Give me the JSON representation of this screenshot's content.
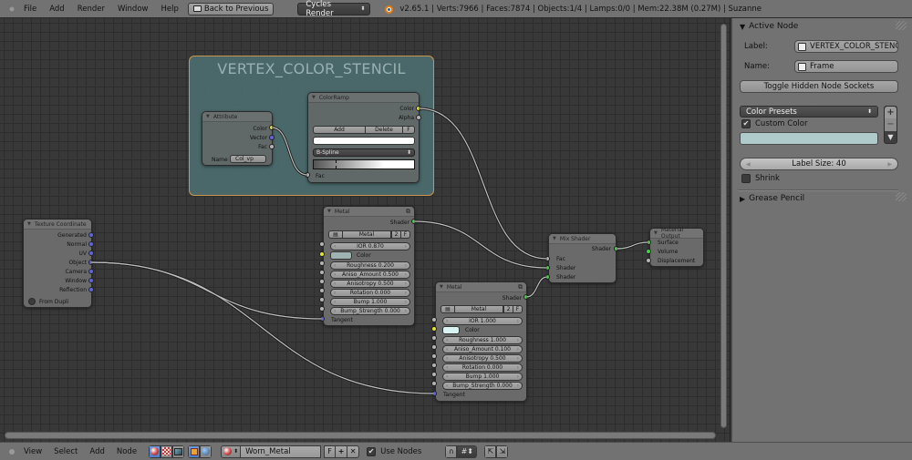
{
  "topbar": {
    "menus": [
      "File",
      "Add",
      "Render",
      "Window",
      "Help"
    ],
    "back_button": "Back to Previous",
    "render_engine": "Cycles Render",
    "stats": "v2.65.1 | Verts:7966 | Faces:7874 | Objects:1/4 | Lamps:0/0 | Mem:22.38M (0.27M) | Suzanne"
  },
  "properties": {
    "active_node_header": "Active Node",
    "label_caption": "Label:",
    "label_value": "VERTEX_COLOR_STENCIL",
    "name_caption": "Name:",
    "name_value": "Frame",
    "toggle_button": "Toggle Hidden Node Sockets",
    "color_presets": "Color Presets",
    "custom_color": "Custom Color",
    "custom_color_checked": true,
    "custom_color_hex": "#b0cacc",
    "label_size": "Label Size: 40",
    "shrink": "Shrink",
    "shrink_checked": false,
    "grease_pencil_header": "Grease Pencil"
  },
  "frame": {
    "label": "VERTEX_COLOR_STENCIL"
  },
  "nodes": {
    "attribute": {
      "title": "Attribute",
      "outputs": [
        "Color",
        "Vector",
        "Fac"
      ],
      "name_label": "Name",
      "name_value": "Col_vp"
    },
    "colorramp": {
      "title": "ColorRamp",
      "outputs": [
        "Color",
        "Alpha"
      ],
      "add": "Add",
      "delete": "Delete",
      "flip": "F",
      "interpolation": "B-Spline",
      "input": "Fac"
    },
    "texcoord": {
      "title": "Texture Coordinate",
      "outputs": [
        "Generated",
        "Normal",
        "UV",
        "Object",
        "Camera",
        "Window",
        "Reflection"
      ],
      "from_dupli": "From Dupli"
    },
    "metal1": {
      "title": "Metal",
      "output": "Shader",
      "group_name": "Metal",
      "users": "2",
      "fake": "F",
      "fields": [
        "IOR 0.870",
        "Roughness 0.200",
        "Aniso_Amount 0.500",
        "Anisotropy 0.500",
        "Rotation 0.000",
        "Bump 1.000",
        "Bump_Strength 0.000"
      ],
      "color_label": "Color",
      "color_hex": "#9fb3b3",
      "tangent": "Tangent"
    },
    "metal2": {
      "title": "Metal",
      "output": "Shader",
      "group_name": "Metal",
      "users": "2",
      "fake": "F",
      "fields": [
        "IOR 1.000",
        "Roughness 1.000",
        "Aniso_Amount 0.100",
        "Anisotropy 0.500",
        "Rotation 0.000",
        "Bump 1.000",
        "Bump_Strength 0.000"
      ],
      "color_label": "Color",
      "color_hex": "#d9f2f2",
      "tangent": "Tangent"
    },
    "mixshader": {
      "title": "Mix Shader",
      "output": "Shader",
      "inputs": [
        "Fac",
        "Shader",
        "Shader"
      ]
    },
    "output": {
      "title": "Material Output",
      "inputs": [
        "Surface",
        "Volume",
        "Displacement"
      ]
    }
  },
  "bottombar": {
    "menus": [
      "View",
      "Select",
      "Add",
      "Node"
    ],
    "material_name": "Worn_Metal",
    "fake_user": "F",
    "use_nodes": "Use Nodes",
    "use_nodes_checked": true
  }
}
